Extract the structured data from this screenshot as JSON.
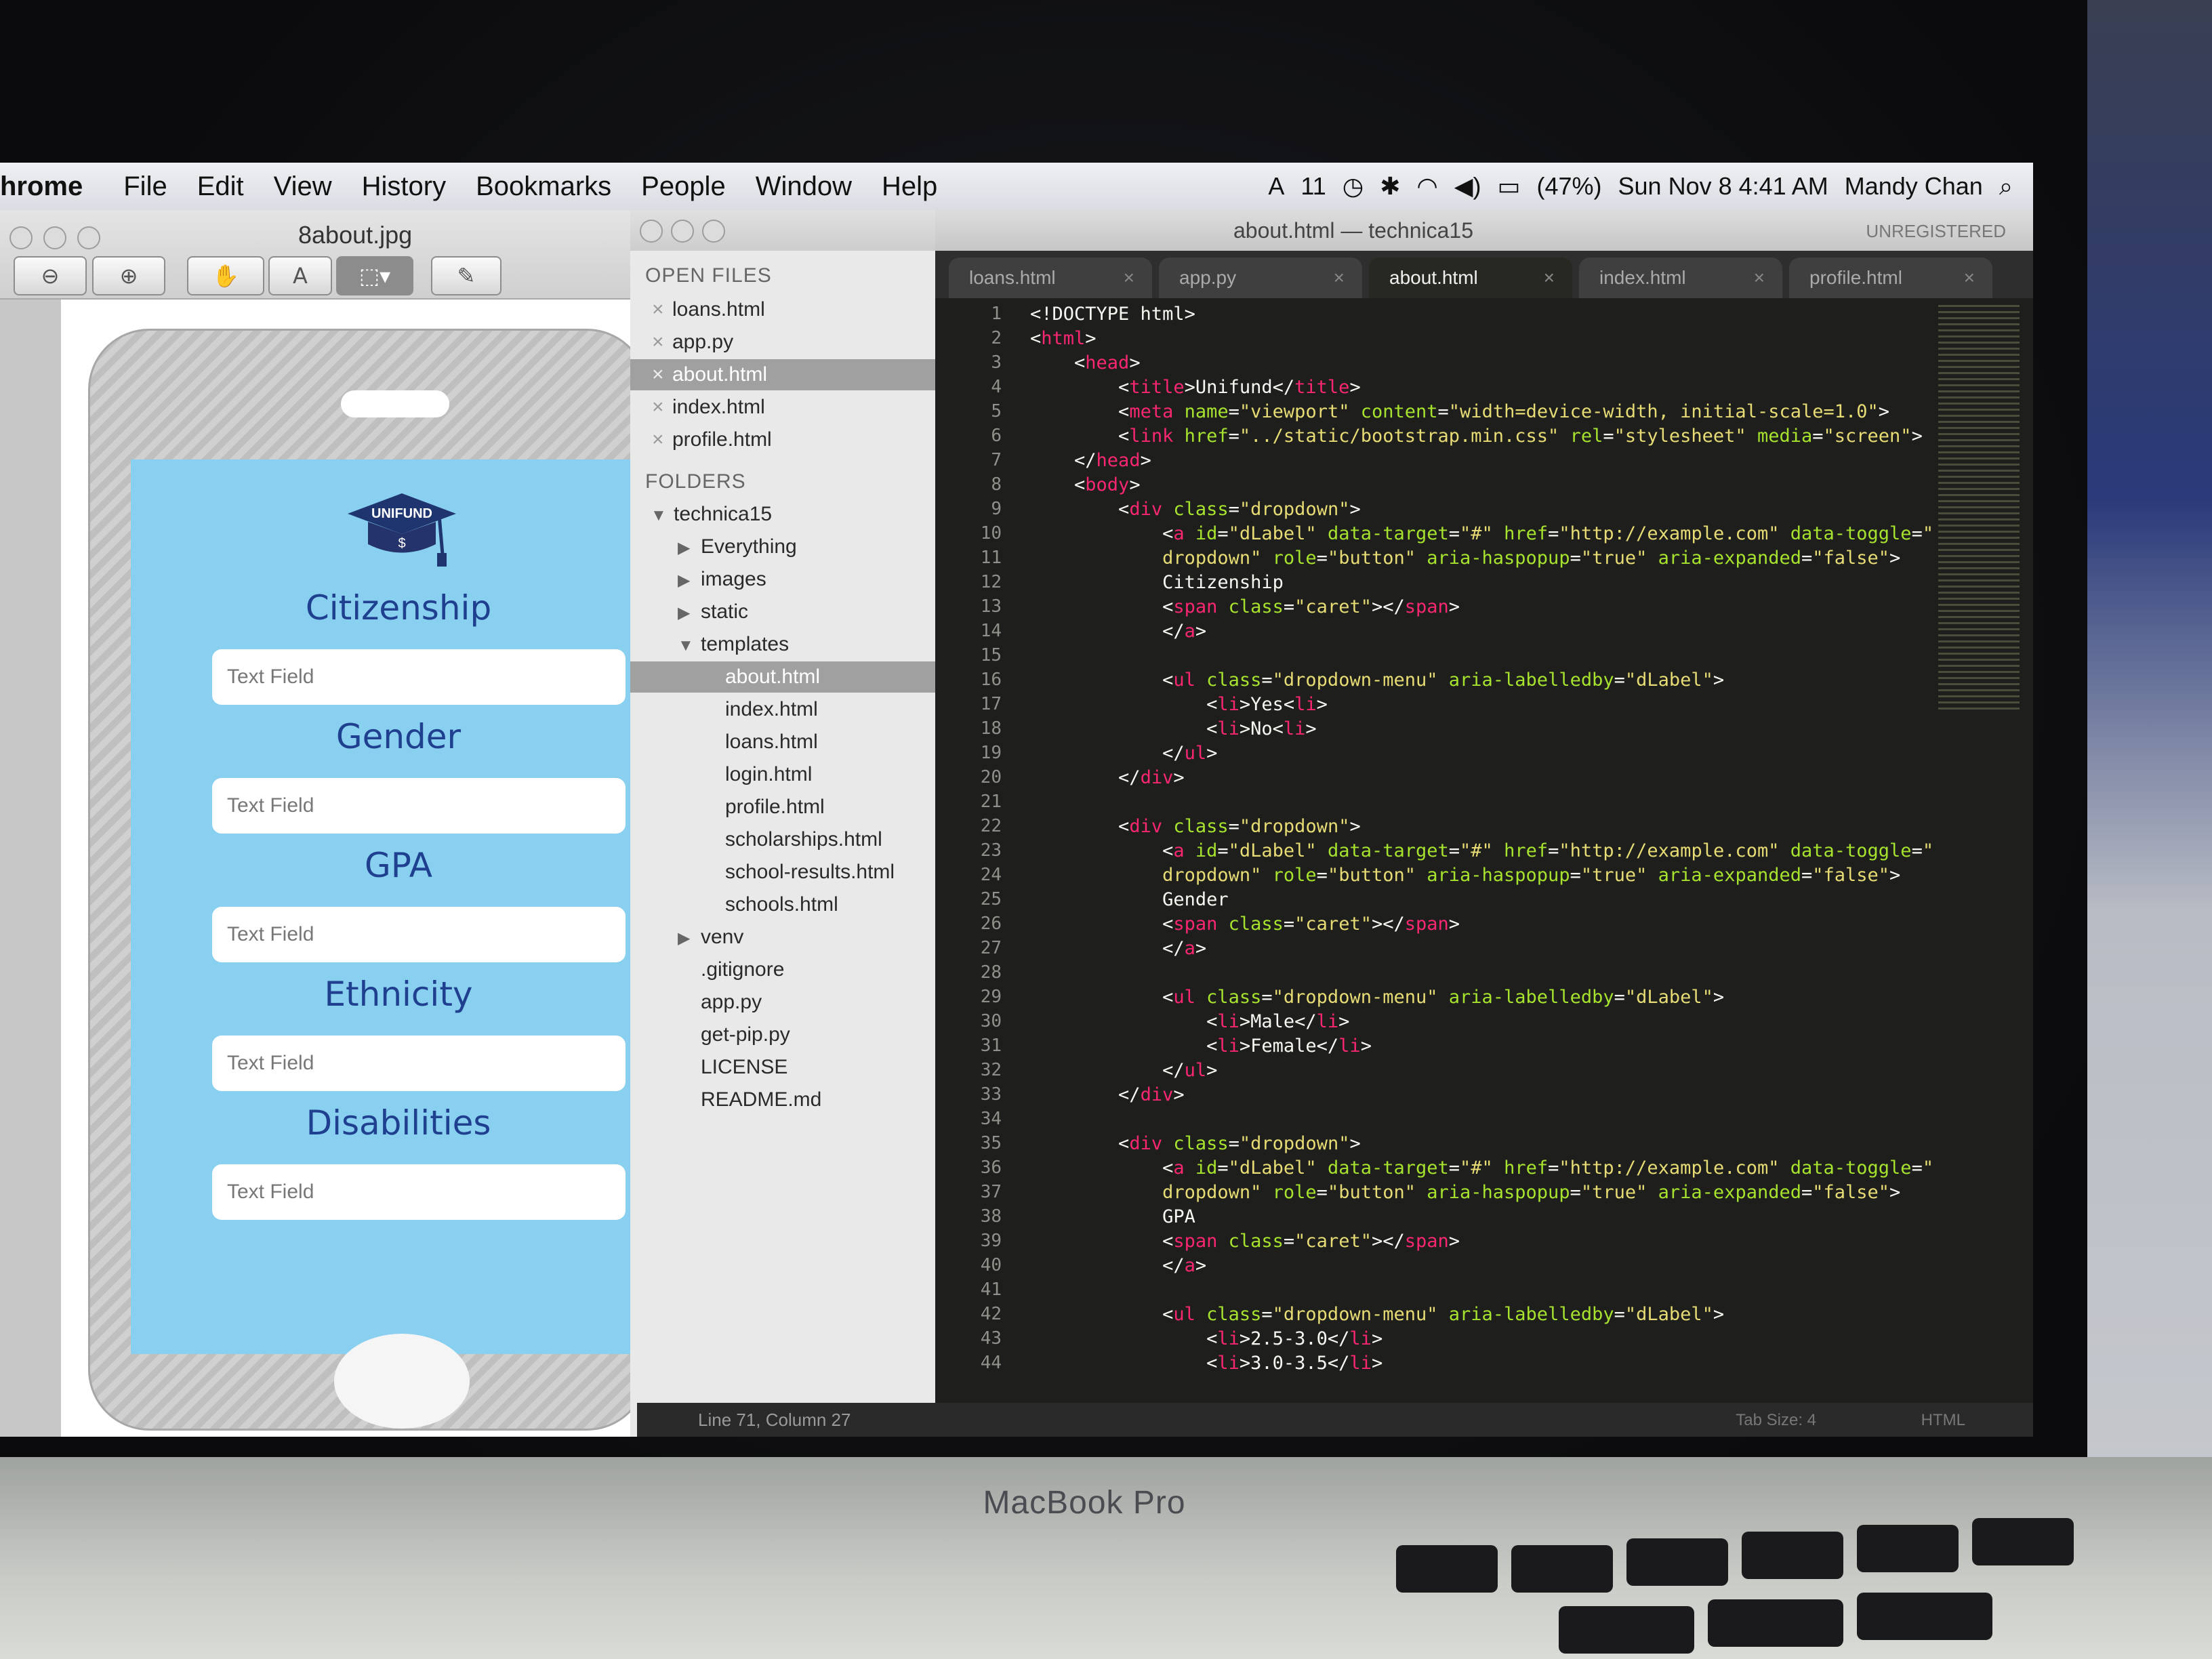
{
  "menubar": {
    "app": "hrome",
    "items": [
      "File",
      "Edit",
      "View",
      "History",
      "Bookmarks",
      "People",
      "Window",
      "Help"
    ],
    "status": {
      "input_badge": "11",
      "battery": "(47%)",
      "datetime": "Sun Nov 8  4:41 AM",
      "user": "Mandy Chan"
    }
  },
  "preview": {
    "title": "8about.jpg",
    "toolbar": [
      "zoom-out",
      "zoom-in",
      "hand",
      "text-select",
      "rect-select",
      "annotate"
    ],
    "app": {
      "logo_text": "UNIFUND",
      "fields": [
        {
          "label": "Citizenship",
          "placeholder": "Text Field"
        },
        {
          "label": "Gender",
          "placeholder": "Text Field"
        },
        {
          "label": "GPA",
          "placeholder": "Text Field"
        },
        {
          "label": "Ethnicity",
          "placeholder": "Text Field"
        },
        {
          "label": "Disabilities",
          "placeholder": "Text Field"
        }
      ]
    }
  },
  "sidebar": {
    "open_files_heading": "OPEN FILES",
    "open_files": [
      "loans.html",
      "app.py",
      "about.html",
      "index.html",
      "profile.html"
    ],
    "folders_heading": "FOLDERS",
    "root": "technica15",
    "folders": [
      "Everything",
      "images",
      "static",
      "templates"
    ],
    "templates": [
      "about.html",
      "index.html",
      "loans.html",
      "login.html",
      "profile.html",
      "scholarships.html",
      "school-results.html",
      "schools.html"
    ],
    "root_items": [
      "venv",
      ".gitignore",
      "app.py",
      "get-pip.py",
      "LICENSE",
      "README.md"
    ]
  },
  "editor": {
    "title": "about.html — technica15",
    "unregistered": "UNREGISTERED",
    "tabs": [
      "loans.html",
      "app.py",
      "about.html",
      "index.html",
      "profile.html"
    ],
    "active_tab": "about.html",
    "status": {
      "cursor": "Line 71, Column 27",
      "tab_size": "Tab Size: 4",
      "syntax": "HTML"
    },
    "line_numbers": [
      "1",
      "2",
      "3",
      "4",
      "5",
      "6",
      "7",
      "8",
      "9",
      "10",
      "11",
      "12",
      "13",
      "14",
      "15",
      "16",
      "17",
      "18",
      "19",
      "20",
      "21",
      "22",
      "23",
      "24",
      "25",
      "26",
      "27",
      "28",
      "29",
      "30",
      "31",
      "32",
      "33",
      "34",
      "35",
      "36",
      "37",
      "38",
      "39",
      "40",
      "41",
      "42",
      "43",
      "44"
    ]
  },
  "laptop": {
    "model": "MacBook Pro"
  },
  "colors": {
    "app_bg": "#89cff0",
    "label": "#1f3f8f",
    "editor_bg": "#1e1f1c"
  }
}
